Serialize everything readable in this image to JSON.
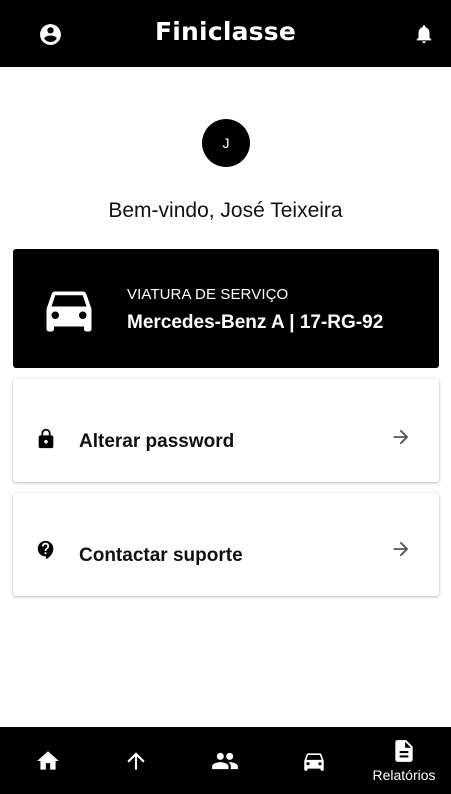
{
  "header": {
    "title": "Finiclasse",
    "left_icon": "account-circle-icon",
    "right_icon": "bell-icon"
  },
  "profile": {
    "avatar_initial": "J",
    "welcome_text": "Bem-vindo, José Teixeira"
  },
  "vehicle": {
    "icon": "car-icon",
    "label": "VIATURA DE SERVIÇO",
    "value": "Mercedes-Benz A | 17-RG-92"
  },
  "actions": [
    {
      "icon": "lock-icon",
      "label": "Alterar password",
      "arrow": "arrow-right-icon"
    },
    {
      "icon": "help-icon",
      "label": "Contactar suporte",
      "arrow": "arrow-right-icon"
    }
  ],
  "bottom_nav": {
    "items": [
      {
        "icon": "home-icon",
        "label": ""
      },
      {
        "icon": "arrow-up-icon",
        "label": ""
      },
      {
        "icon": "people-icon",
        "label": ""
      },
      {
        "icon": "car-icon",
        "label": ""
      },
      {
        "icon": "document-icon",
        "label": "Relatórios"
      }
    ]
  },
  "colors": {
    "bar_background": "#000000",
    "bar_foreground": "#ffffff",
    "arrow_color": "#555555"
  }
}
